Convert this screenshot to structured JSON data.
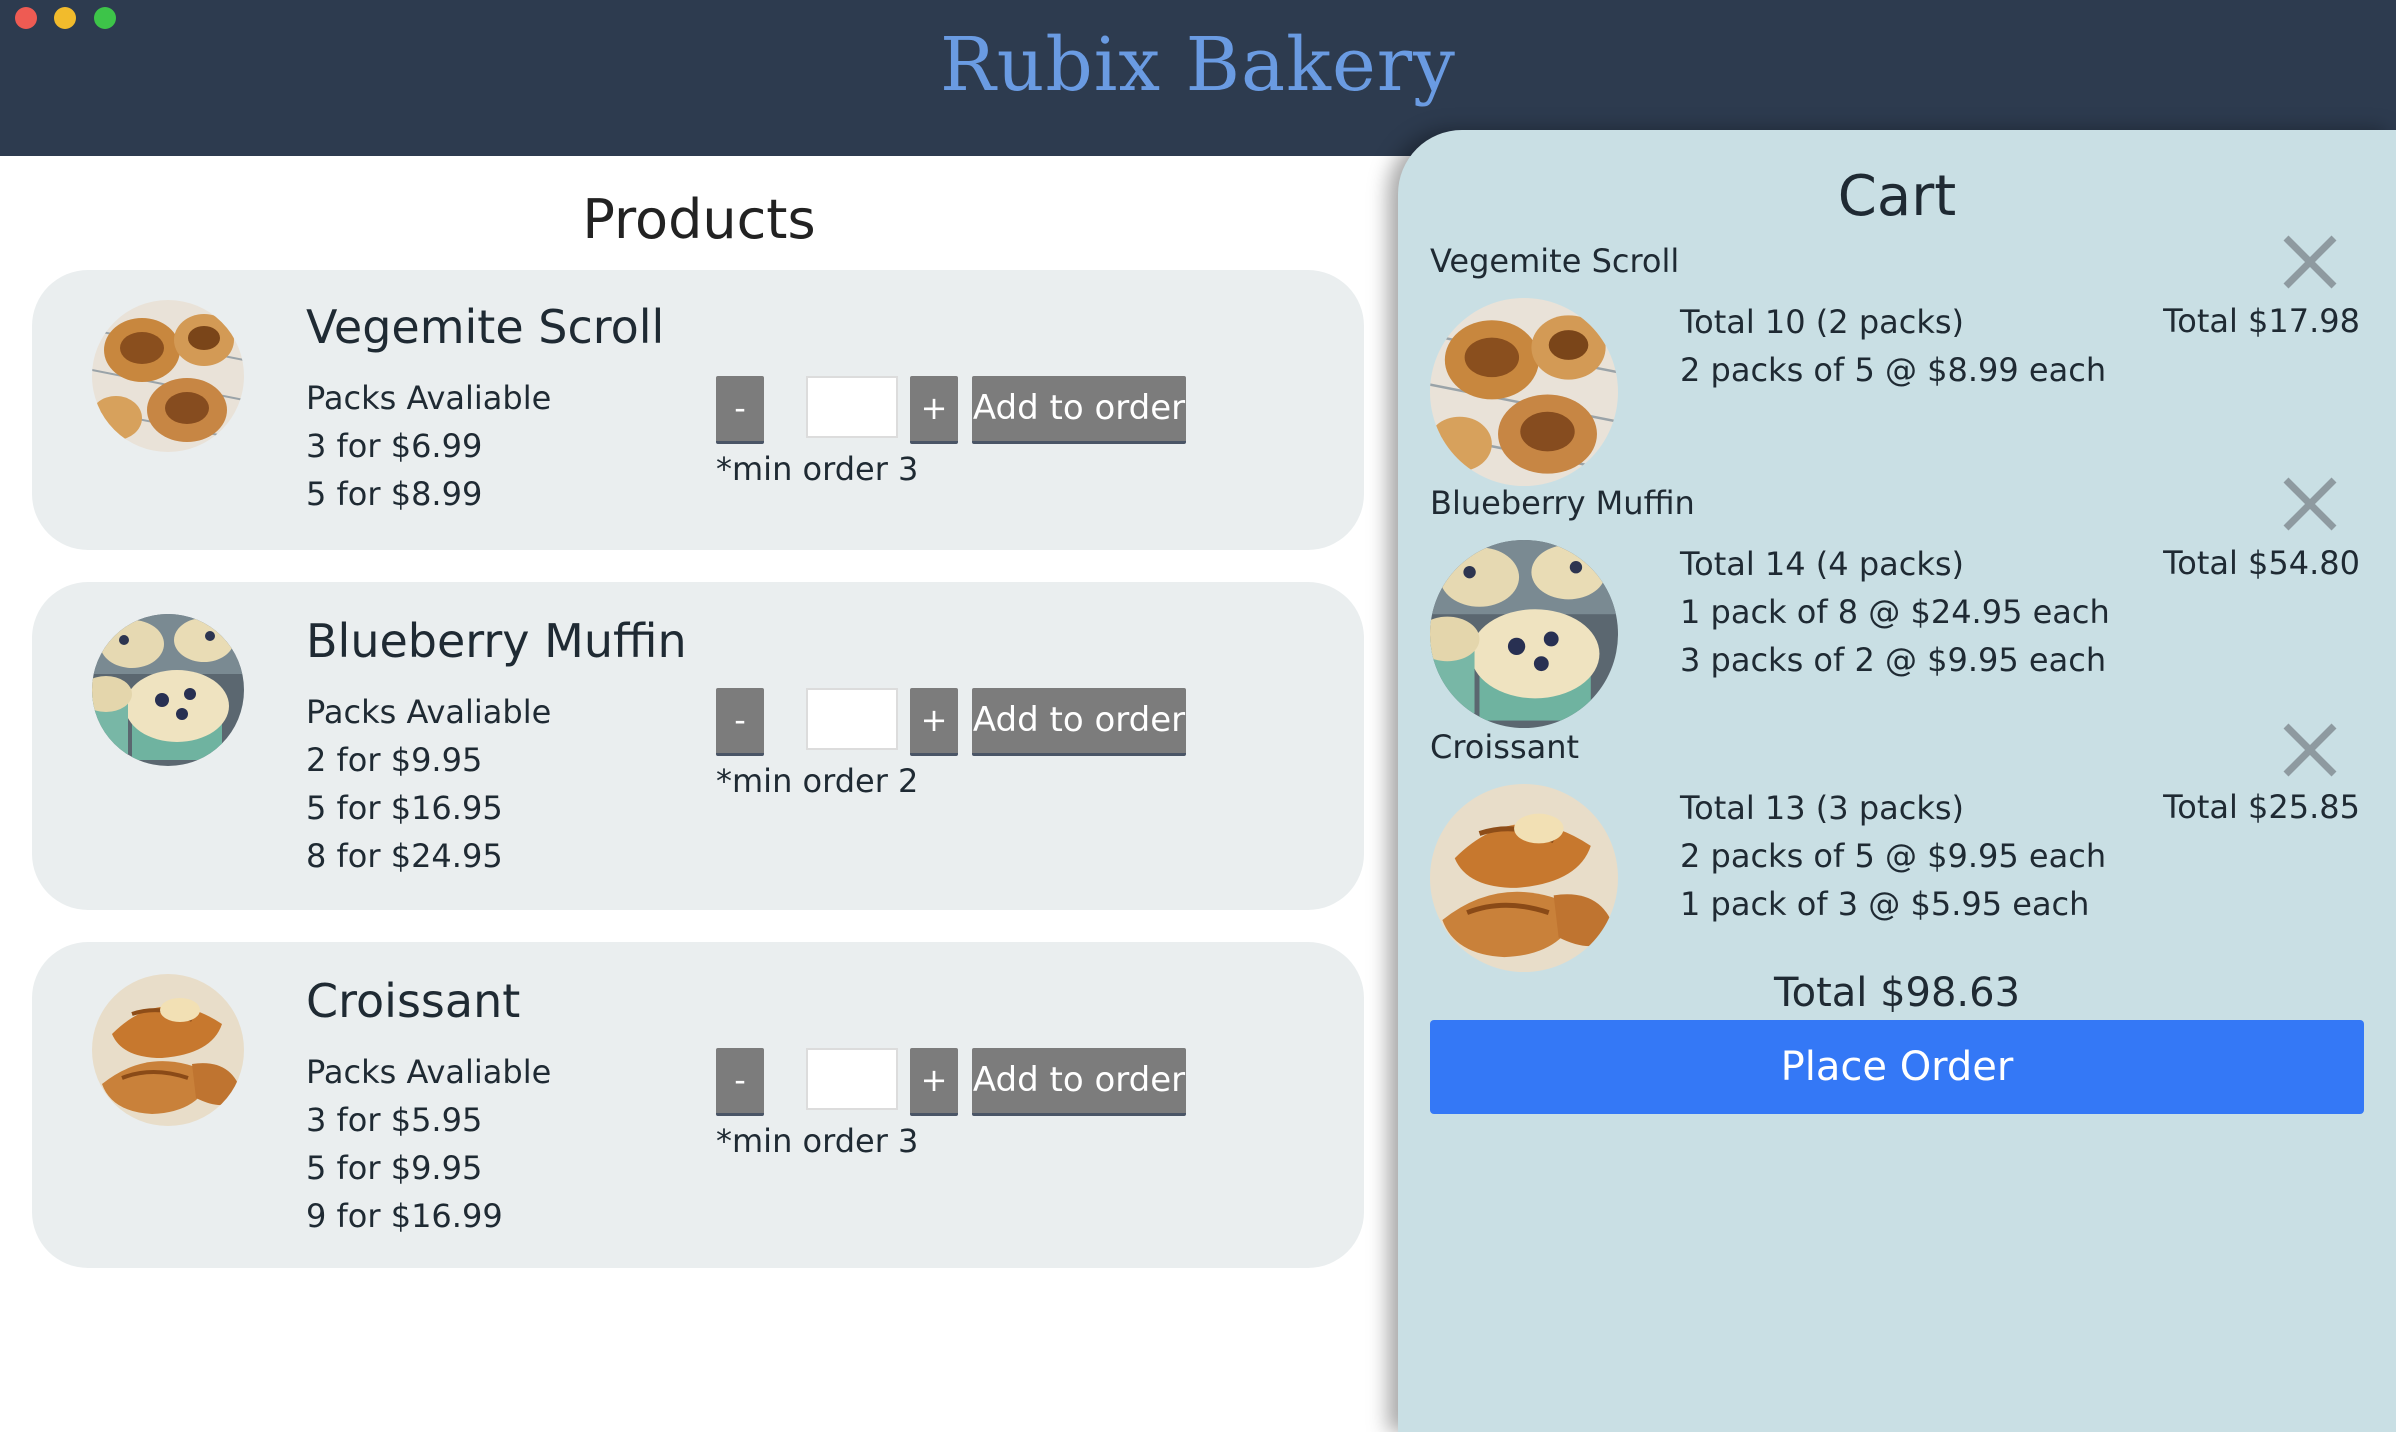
{
  "app": {
    "title": "Rubix Bakery"
  },
  "products": {
    "title": "Products",
    "items": [
      {
        "name": "Vegemite Scroll",
        "packs_label": "Packs Avaliable",
        "packs": [
          "3 for $6.99",
          "5 for $8.99"
        ],
        "minus": "-",
        "plus": "+",
        "quantity_value": "",
        "add_label": "Add to order",
        "min_order": "*min order 3",
        "image": "vegemite-scroll"
      },
      {
        "name": "Blueberry Muffin",
        "packs_label": "Packs Avaliable",
        "packs": [
          "2 for $9.95",
          "5 for $16.95",
          "8 for $24.95"
        ],
        "minus": "-",
        "plus": "+",
        "quantity_value": "",
        "add_label": "Add to order",
        "min_order": "*min order 2",
        "image": "blueberry-muffin"
      },
      {
        "name": "Croissant",
        "packs_label": "Packs Avaliable",
        "packs": [
          "3 for $5.95",
          "5 for $9.95",
          "9 for $16.99"
        ],
        "minus": "-",
        "plus": "+",
        "quantity_value": "",
        "add_label": "Add to order",
        "min_order": "*min order 3",
        "image": "croissant"
      }
    ]
  },
  "cart": {
    "title": "Cart",
    "items": [
      {
        "name": "Vegemite Scroll",
        "lines": [
          "Total 10 (2 packs)",
          "2 packs of 5 @ $8.99 each"
        ],
        "total": "Total $17.98",
        "remove_icon": "close-icon"
      },
      {
        "name": "Blueberry Muffin",
        "lines": [
          "Total 14 (4 packs)",
          "1 pack of 8 @ $24.95 each",
          "3 packs of 2 @ $9.95 each"
        ],
        "total": "Total $54.80",
        "remove_icon": "close-icon"
      },
      {
        "name": "Croissant",
        "lines": [
          "Total 13 (3 packs)",
          "2 packs of 5 @ $9.95 each",
          "1 pack of 3 @ $5.95 each"
        ],
        "total": "Total $25.85",
        "remove_icon": "close-icon"
      }
    ],
    "grand_total": "Total $98.63",
    "place_order_label": "Place Order"
  },
  "colors": {
    "header_bg": "#2d3b4f",
    "title_color": "#6a9be2",
    "card_bg": "#eaeeef",
    "cart_bg": "#c9dfe4",
    "button_gray": "#7c7c7c",
    "place_order_blue": "#3478f6"
  }
}
